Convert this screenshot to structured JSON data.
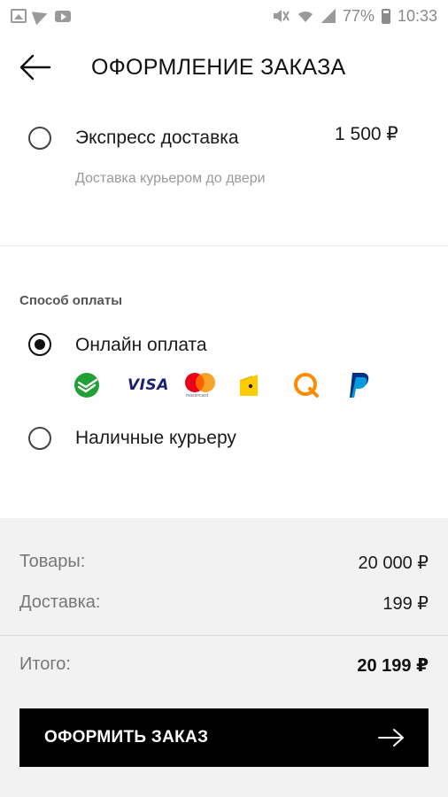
{
  "status_bar": {
    "battery": "77%",
    "time": "10:33",
    "left_icons": [
      "image-icon",
      "telegram-icon",
      "youtube-icon"
    ],
    "right_icons": [
      "mute-icon",
      "wifi-icon",
      "signal-icon",
      "battery-icon"
    ]
  },
  "header": {
    "title": "ОФОРМЛЕНИЕ ЗАКАЗА",
    "back_icon": "arrow-left-icon"
  },
  "delivery": {
    "label": "Экспресс доставка",
    "subtitle": "Доставка курьером до двери",
    "price": "1 500 ₽",
    "selected": false
  },
  "payment": {
    "section_title": "Способ оплаты",
    "options": [
      {
        "label": "Онлайн оплата",
        "selected": true
      },
      {
        "label": "Наличные курьеру",
        "selected": false
      }
    ],
    "icons": [
      "sberbank-icon",
      "visa-icon",
      "mastercard-icon",
      "yandex-money-icon",
      "qiwi-icon",
      "paypal-icon"
    ],
    "visa_text": "VISA",
    "mastercard_text": "mastercard"
  },
  "summary": {
    "goods_label": "Товары:",
    "goods_value": "20 000 ₽",
    "delivery_label": "Доставка:",
    "delivery_value": "199 ₽",
    "total_label": "Итого:",
    "total_value": "20 199 ₽"
  },
  "checkout": {
    "label": "ОФОРМИТЬ ЗАКАЗ",
    "icon": "arrow-right-icon"
  },
  "colors": {
    "accent": "#000000",
    "summary_bg": "#f2f2f2",
    "sberbank": "#21a038",
    "visa": "#1a1f71",
    "mastercard_red": "#eb001b",
    "mastercard_orange": "#f79e1b",
    "yandex": "#ffcc00",
    "qiwi": "#ff8c00",
    "paypal": "#003087"
  }
}
